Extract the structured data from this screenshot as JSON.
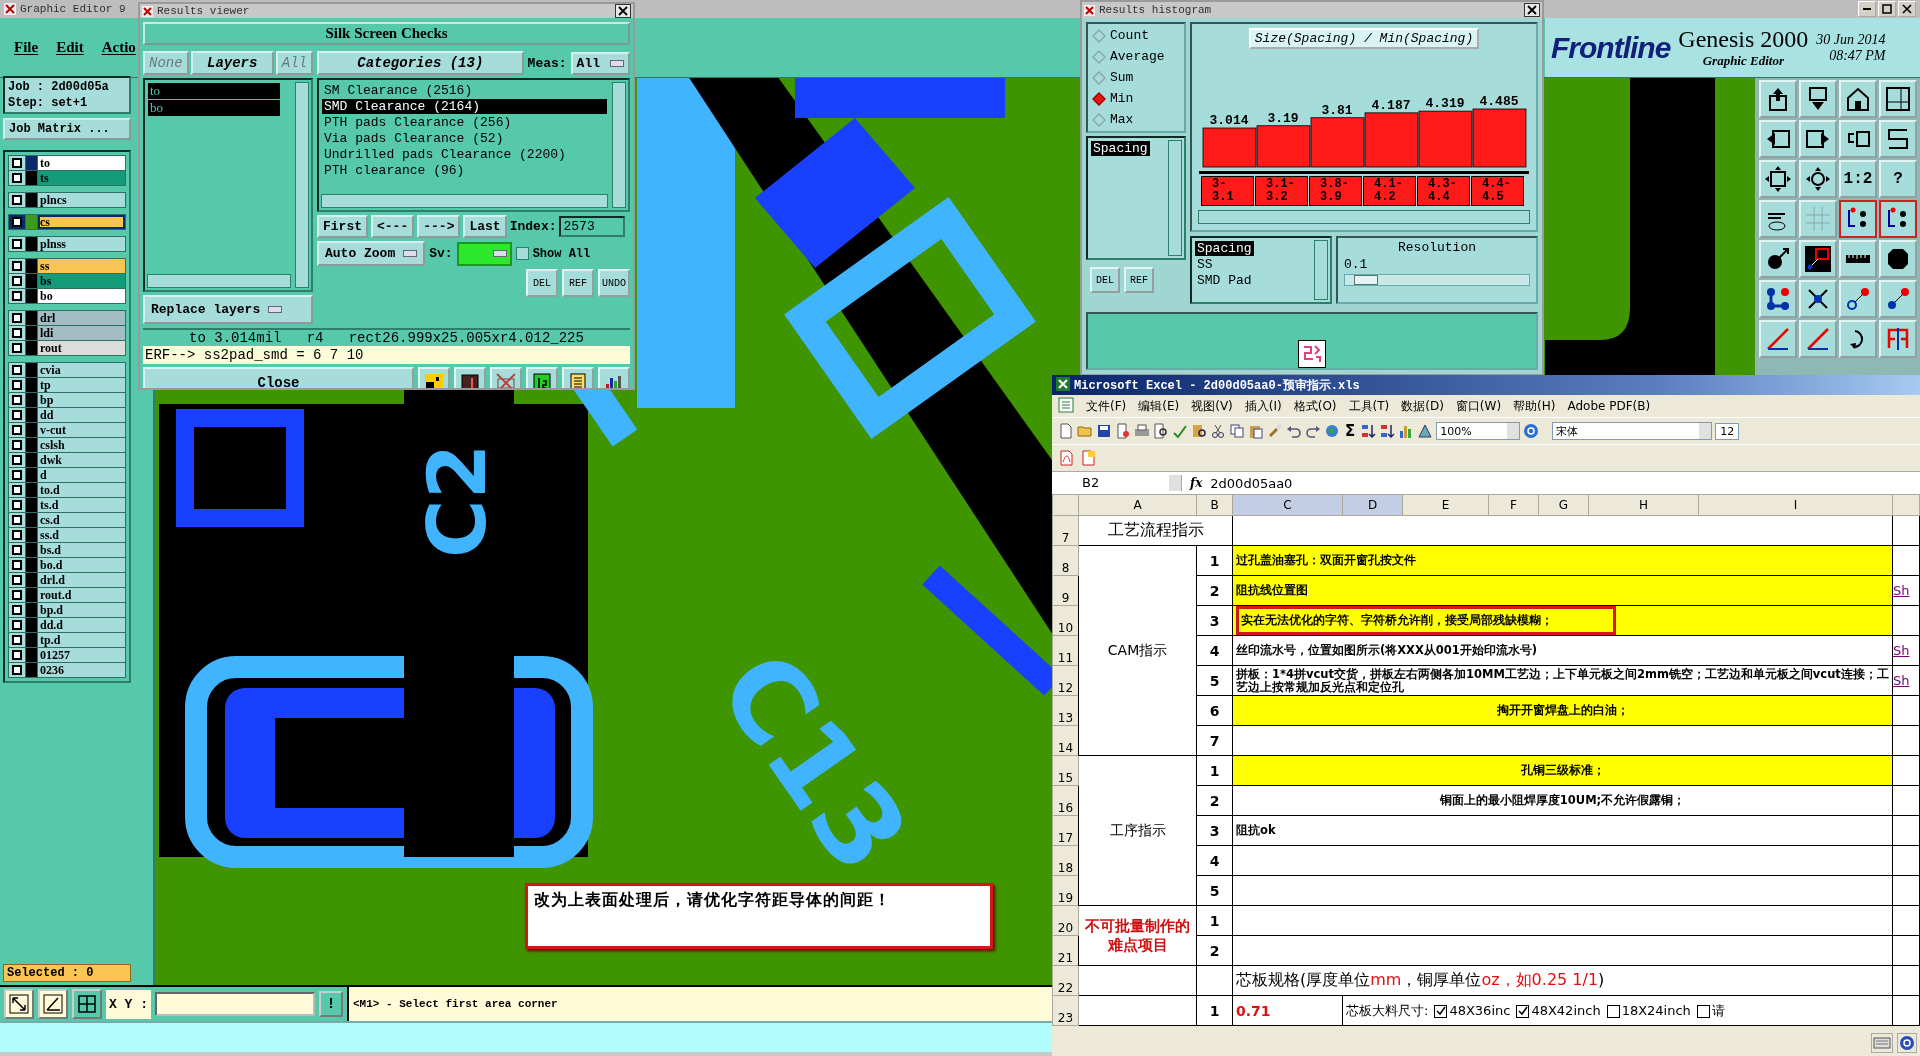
{
  "main_window": {
    "title": "Graphic Editor 9",
    "menu": [
      "File",
      "Edit",
      "Actio"
    ],
    "job": "Job : 2d00d05a",
    "step": "Step: set+1",
    "job_matrix": "Job Matrix ...",
    "layer_groups": [
      [
        {
          "name": "to",
          "color": "#ffffff",
          "swatch": {
            "color": "#0a2a6a"
          },
          "checked": false,
          "work": false
        },
        {
          "name": "ts",
          "color": "#169b7a",
          "swatch": {
            "color": "#000000"
          },
          "checked": false,
          "work": false
        }
      ],
      [
        {
          "name": "plncs",
          "color": "#a6dcdc",
          "swatch": {
            "color": "#000000"
          },
          "checked": false,
          "work": false
        }
      ],
      [
        {
          "name": "cs",
          "color": "#f8c454",
          "swatch": {
            "color": "#3c9a22"
          },
          "checked": false,
          "work": true
        }
      ],
      [
        {
          "name": "plnss",
          "color": "#a6dcdc",
          "swatch": {
            "color": "#000000"
          },
          "checked": false,
          "work": false
        }
      ],
      [
        {
          "name": "ss",
          "color": "#f8c454",
          "swatch": {
            "color": "#000000"
          },
          "checked": false,
          "work": false
        },
        {
          "name": "bs",
          "color": "#169b7a",
          "swatch": {
            "color": "#000000"
          },
          "checked": false,
          "work": false
        },
        {
          "name": "bo",
          "color": "#ffffff",
          "swatch": {
            "color": "#000000"
          },
          "checked": false,
          "work": false
        }
      ],
      [
        {
          "name": "drl",
          "color": "#a4bcc4",
          "swatch": {
            "color": "#000000"
          },
          "checked": false,
          "work": false
        },
        {
          "name": "ldi",
          "color": "#a4bcc4",
          "swatch": {
            "color": "#000000"
          },
          "checked": false,
          "work": false
        },
        {
          "name": "rout",
          "color": "#dcdcdc",
          "swatch": {
            "color": "#000000"
          },
          "checked": false,
          "work": false
        }
      ],
      [
        {
          "name": "cvia",
          "color": "#a6dcdc",
          "swatch": {
            "color": "#000000"
          },
          "checked": false,
          "work": false
        },
        {
          "name": "tp",
          "color": "#a6dcdc",
          "swatch": {
            "color": "#000000"
          },
          "checked": false,
          "work": false
        },
        {
          "name": "bp",
          "color": "#a6dcdc",
          "swatch": {
            "color": "#000000"
          },
          "checked": false,
          "work": false
        },
        {
          "name": "dd",
          "color": "#a6dcdc",
          "swatch": {
            "color": "#000000"
          },
          "checked": false,
          "work": false
        },
        {
          "name": "v-cut",
          "color": "#a6dcdc",
          "swatch": {
            "color": "#000000"
          },
          "checked": false,
          "work": false
        },
        {
          "name": "cslsh",
          "color": "#a6dcdc",
          "swatch": {
            "color": "#000000"
          },
          "checked": false,
          "work": false
        },
        {
          "name": "dwk",
          "color": "#a6dcdc",
          "swatch": {
            "color": "#000000"
          },
          "checked": false,
          "work": false
        },
        {
          "name": "d",
          "color": "#a6dcdc",
          "swatch": {
            "color": "#000000"
          },
          "checked": false,
          "work": false
        },
        {
          "name": "to.d",
          "color": "#a6dcdc",
          "swatch": {
            "color": "#000000"
          },
          "checked": false,
          "work": false
        },
        {
          "name": "ts.d",
          "color": "#a6dcdc",
          "swatch": {
            "color": "#000000"
          },
          "checked": false,
          "work": false
        },
        {
          "name": "cs.d",
          "color": "#a6dcdc",
          "swatch": {
            "color": "#000000"
          },
          "checked": false,
          "work": false
        },
        {
          "name": "ss.d",
          "color": "#a6dcdc",
          "swatch": {
            "color": "#000000"
          },
          "checked": false,
          "work": false
        },
        {
          "name": "bs.d",
          "color": "#a6dcdc",
          "swatch": {
            "color": "#000000"
          },
          "checked": false,
          "work": false
        },
        {
          "name": "bo.d",
          "color": "#a6dcdc",
          "swatch": {
            "color": "#000000"
          },
          "checked": false,
          "work": false
        },
        {
          "name": "drl.d",
          "color": "#a6dcdc",
          "swatch": {
            "color": "#000000"
          },
          "checked": false,
          "work": false
        },
        {
          "name": "rout.d",
          "color": "#a6dcdc",
          "swatch": {
            "color": "#000000"
          },
          "checked": false,
          "work": false
        },
        {
          "name": "bp.d",
          "color": "#a6dcdc",
          "swatch": {
            "color": "#000000"
          },
          "checked": false,
          "work": false
        },
        {
          "name": "dd.d",
          "color": "#a6dcdc",
          "swatch": {
            "color": "#000000"
          },
          "checked": false,
          "work": false
        },
        {
          "name": "tp.d",
          "color": "#a6dcdc",
          "swatch": {
            "color": "#000000"
          },
          "checked": false,
          "work": false
        },
        {
          "name": "01257",
          "color": "#a6dcdc",
          "swatch": {
            "color": "#000000"
          },
          "checked": false,
          "work": false
        },
        {
          "name": "0236",
          "color": "#a6dcdc",
          "swatch": {
            "color": "#000000"
          },
          "checked": false,
          "work": false
        }
      ]
    ],
    "selected_count": "Selected : 0",
    "xy_label": "X Y :",
    "prompt_button": "!",
    "prompt": "<M1> - Select first area corner",
    "note": "改为上表面处理后，请优化字符距导体的间距！",
    "canvas_labels": [
      "C13",
      "C2"
    ],
    "brand": {
      "logo": "Frontline",
      "product": "Genesis 2000",
      "subtitle": "Graphic Editor",
      "date": "30 Jun 2014",
      "time": "08:47 PM"
    },
    "tools": [
      {
        "kind": "box-up-arrow"
      },
      {
        "kind": "box-down-arrow"
      },
      {
        "kind": "house"
      },
      {
        "kind": "frame"
      },
      {
        "kind": "left-arrow-box"
      },
      {
        "kind": "right-arrow-box"
      },
      {
        "kind": "undo-box"
      },
      {
        "kind": "zigzag"
      },
      {
        "kind": "expand-box"
      },
      {
        "kind": "move-box"
      },
      {
        "kind": "label",
        "label": "1:2"
      },
      {
        "kind": "label",
        "label": "?"
      },
      {
        "kind": "tools"
      },
      {
        "kind": "grid"
      },
      {
        "kind": "circuit-board"
      },
      {
        "kind": "circuit-board"
      },
      {
        "kind": "pad-arrow"
      },
      {
        "kind": "red-square"
      },
      {
        "kind": "ruler"
      },
      {
        "kind": "octagon-pad"
      },
      {
        "kind": "connected-nodes"
      },
      {
        "kind": "cross"
      },
      {
        "kind": "open-link"
      },
      {
        "kind": "filled-link"
      },
      {
        "kind": "red-slash"
      },
      {
        "kind": "red-slash"
      },
      {
        "kind": "rotate-arrow"
      },
      {
        "kind": "mirror"
      }
    ]
  },
  "results_viewer": {
    "title": "Results viewer",
    "heading": "Silk Screen Checks",
    "layer_buttons": [
      {
        "label": "None",
        "disabled": true
      },
      {
        "label": "Layers",
        "disabled": false
      },
      {
        "label": "All",
        "disabled": true
      }
    ],
    "layers": [
      {
        "name": "to",
        "selected": true
      },
      {
        "name": "bo",
        "selected": true
      }
    ],
    "categories_button": "Categories (13)",
    "meas_label": "Meas:",
    "meas_value": "All",
    "categories": [
      {
        "label": "SM Clearance (2516)",
        "selected": false
      },
      {
        "label": "SMD Clearance (2164)",
        "selected": true
      },
      {
        "label": "PTH pads Clearance (256)",
        "selected": false
      },
      {
        "label": "Via pads Clearance (52)",
        "selected": false
      },
      {
        "label": "Undrilled pads Clearance (2200)",
        "selected": false
      },
      {
        "label": "PTH clearance (96)",
        "selected": false
      }
    ],
    "nav": [
      "First",
      "<---",
      "--->",
      "Last"
    ],
    "index_label": "Index:",
    "index_value": "2573",
    "zoom_mode": "Auto Zoom",
    "sv_label": "Sv:",
    "show_all": {
      "label": "Show All",
      "checked": false
    },
    "replace": "Replace layers",
    "action_buttons": [
      "DEL",
      "REF",
      "UNDO"
    ],
    "info": "to 3.014mil   r4   rect26.999x25.005xr4.012_225",
    "erf": "ERF--> ss2pad_smd = 6 7 10",
    "close": "Close"
  },
  "histogram": {
    "title": "Results histogram",
    "modes": [
      {
        "label": "Count",
        "selected": false
      },
      {
        "label": "Average",
        "selected": false
      },
      {
        "label": "Sum",
        "selected": false
      },
      {
        "label": "Min",
        "selected": true
      },
      {
        "label": "Max",
        "selected": false
      }
    ],
    "attributes": [
      {
        "label": "Spacing",
        "selected": true
      }
    ],
    "chart_data": {
      "type": "bar",
      "title": "Size(Spacing) / Min(Spacing)",
      "categories": [
        "3-3.1",
        "3.1-3.2",
        "3.8-3.9",
        "4.1-4.2",
        "4.3-4.4",
        "4.4-4.5"
      ],
      "values": [
        3.014,
        3.19,
        3.81,
        4.187,
        4.319,
        4.485
      ],
      "data_labels": true
    },
    "fields": [
      {
        "label": "Spacing",
        "selected": true
      },
      {
        "label": "SS",
        "selected": false
      },
      {
        "label": "SMD Pad",
        "selected": false
      }
    ],
    "resolution_label": "Resolution",
    "resolution_value": "0.1",
    "resolution": {
      "level": 0.05
    },
    "buttons": [
      "DEL",
      "REF"
    ]
  },
  "excel": {
    "title": "Microsoft Excel - 2d00d05aa0-预审指示.xls",
    "menu": [
      "文件(F)",
      "编辑(E)",
      "视图(V)",
      "插入(I)",
      "格式(O)",
      "工具(T)",
      "数据(D)",
      "窗口(W)",
      "帮助(H)",
      "Adobe PDF(B)"
    ],
    "autosum": "Σ",
    "zoom": "100%",
    "font": "宋体",
    "font_size": "12",
    "cell_ref": "B2",
    "formula_label": "fx",
    "formula": "2d00d05aa0",
    "columns": [
      {
        "label": "A",
        "selected": false
      },
      {
        "label": "B",
        "selected": false
      },
      {
        "label": "C",
        "selected": true
      },
      {
        "label": "D",
        "selected": true
      },
      {
        "label": "E",
        "selected": false
      },
      {
        "label": "F",
        "selected": false
      },
      {
        "label": "G",
        "selected": false
      },
      {
        "label": "H",
        "selected": false
      },
      {
        "label": "I",
        "selected": false
      }
    ],
    "title_row": {
      "row": "7",
      "text": "工艺流程指示"
    },
    "sections": [
      {
        "title": "CAM指示",
        "alert": false,
        "rows": [
          {
            "row": "8",
            "no": "1",
            "text": "过孔盖油塞孔：双面开窗孔按文件",
            "highlight": true,
            "centered": false,
            "marked": false
          },
          {
            "row": "9",
            "no": "2",
            "text": "阻抗线位置图",
            "highlight": true,
            "centered": false,
            "marked": false,
            "link": "Sh"
          },
          {
            "row": "10",
            "no": "3",
            "text": "实在无法优化的字符、字符桥允许削，接受局部残缺模糊；",
            "highlight": true,
            "centered": false,
            "marked": true
          },
          {
            "row": "11",
            "no": "4",
            "text": "丝印流水号，位置如图所示(将XXX从001开始印流水号)",
            "highlight": false,
            "centered": false,
            "marked": false,
            "link": "Sh"
          },
          {
            "row": "12",
            "no": "5",
            "text": "拼板：1*4拼vcut交货，拼板左右两侧各加10MM工艺边；上下单元板之间2mm铣空；工艺边和单元板之间vcut连接；工艺边上按常规加反光点和定位孔",
            "highlight": false,
            "centered": false,
            "marked": false,
            "link": "Sh"
          },
          {
            "row": "13",
            "no": "6",
            "text": "掏开开窗焊盘上的白油；",
            "highlight": true,
            "centered": true,
            "marked": false
          },
          {
            "row": "14",
            "no": "7",
            "highlight": false
          }
        ]
      },
      {
        "title": "工序指示",
        "alert": false,
        "rows": [
          {
            "row": "15",
            "no": "1",
            "text": "孔铜三级标准；",
            "highlight": true,
            "centered": true,
            "marked": false
          },
          {
            "row": "16",
            "no": "2",
            "text": "铜面上的最小阻焊厚度10UM;不允许假露铜；",
            "highlight": false,
            "centered": true,
            "marked": false
          },
          {
            "row": "17",
            "no": "3",
            "text": "阻抗ok",
            "highlight": false,
            "centered": false,
            "marked": false
          },
          {
            "row": "18",
            "no": "4",
            "highlight": false
          },
          {
            "row": "19",
            "no": "5",
            "highlight": false
          }
        ]
      },
      {
        "title": "不可批量制作的难点项目",
        "alert": true,
        "rows": [
          {
            "row": "20",
            "no": "1",
            "highlight": false
          },
          {
            "row": "21",
            "no": "2",
            "highlight": false
          }
        ]
      }
    ],
    "spec_row": {
      "row": "22",
      "parts": [
        {
          "text": "芯板规格(厚度单位",
          "red": false
        },
        {
          "text": "mm",
          "red": true
        },
        {
          "text": "，铜厚单位",
          "red": false
        },
        {
          "text": "oz，如0.25 1/1",
          "red": true
        },
        {
          "text": ")",
          "red": false
        }
      ]
    },
    "core_row": {
      "row": "23",
      "no": "1",
      "thickness": "0.71",
      "label": "芯板大料尺寸:",
      "options": [
        {
          "label": "48X36inc",
          "checked": true
        },
        {
          "label": "48X42inch",
          "checked": true
        },
        {
          "label": "18X24inch",
          "checked": false
        },
        {
          "label": "请",
          "checked": false
        }
      ]
    }
  }
}
